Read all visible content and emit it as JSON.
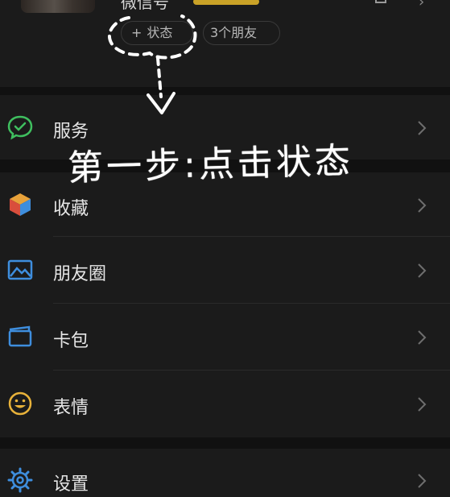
{
  "profile": {
    "nickname": "微信号",
    "status_chip": {
      "icon": "plus-icon",
      "plus": "+",
      "label": "状态"
    },
    "friends_chip": {
      "label": "3个朋友"
    }
  },
  "menu": [
    {
      "id": "services",
      "label": "服务",
      "icon": "services-icon",
      "icon_color": "#3fbf5f"
    },
    {
      "id": "favorites",
      "label": "收藏",
      "icon": "favorites-cube-icon",
      "icon_color": "#e8a23a"
    },
    {
      "id": "moments",
      "label": "朋友圈",
      "icon": "moments-picture-icon",
      "icon_color": "#3e8ede"
    },
    {
      "id": "cards",
      "label": "卡包",
      "icon": "card-wallet-icon",
      "icon_color": "#3e8ede"
    },
    {
      "id": "stickers",
      "label": "表情",
      "icon": "smiley-icon",
      "icon_color": "#e8b23a"
    },
    {
      "id": "settings",
      "label": "设置",
      "icon": "gear-icon",
      "icon_color": "#3e8ede"
    }
  ],
  "annotation": {
    "text": "第一步:点击状态",
    "color": "#ffffff"
  },
  "colors": {
    "background": "#111111",
    "panel": "#1b1b1b",
    "text": "#e6e6e6",
    "muted": "#b8b8b8",
    "chevron": "#6e6e6e"
  }
}
